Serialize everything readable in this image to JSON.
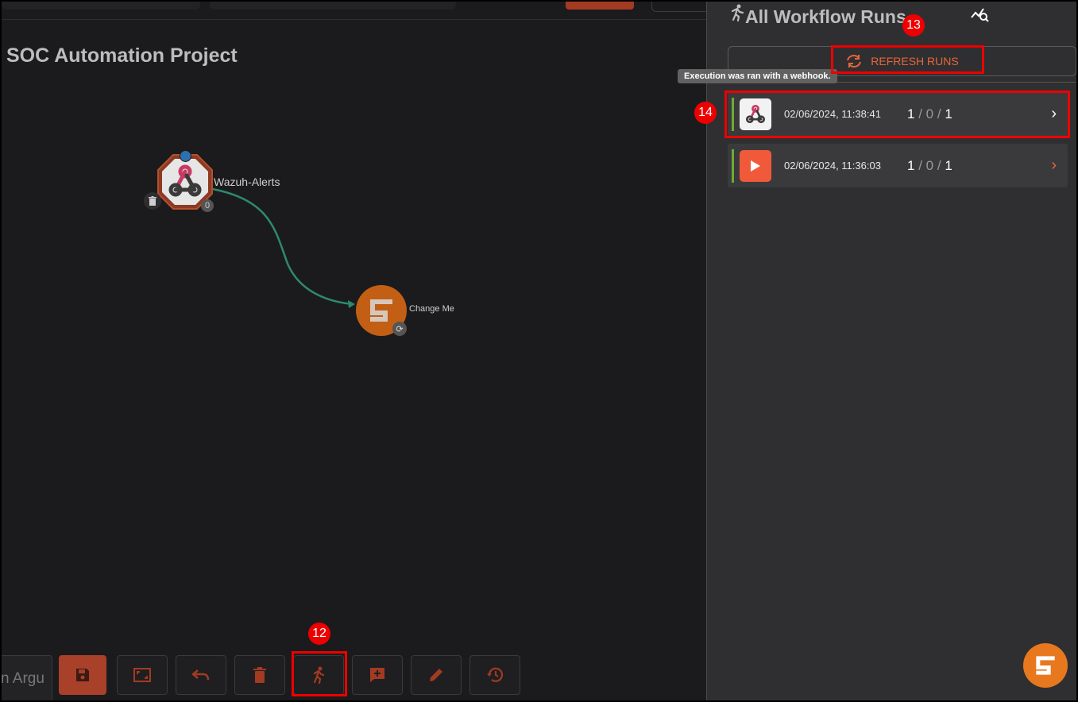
{
  "canvas": {
    "project_title": "SOC Automation Project",
    "nodes": [
      {
        "label": "Wazuh-Alerts",
        "count": "0"
      },
      {
        "label": "Change Me"
      }
    ]
  },
  "toolbar": {
    "argument_input_partial": "n Argu",
    "buttons": [
      "save-icon",
      "fit-screen-icon",
      "undo-icon",
      "delete-icon",
      "run-icon",
      "add-comment-icon",
      "edit-icon",
      "history-icon"
    ]
  },
  "annotations": {
    "badge_12": "12",
    "badge_13": "13",
    "badge_14": "14"
  },
  "panel": {
    "title": "All Workflow Runs",
    "refresh_label": "REFRESH RUNS",
    "tooltip": "Execution was ran with a webhook.",
    "runs": [
      {
        "timestamp": "02/06/2024, 11:38:41",
        "success": "1",
        "failed": "0",
        "total": "1",
        "source_icon": "webhook-icon",
        "chevron_color": "#ffffff"
      },
      {
        "timestamp": "02/06/2024, 11:36:03",
        "success": "1",
        "failed": "0",
        "total": "1",
        "source_icon": "play-icon",
        "chevron_color": "#e8653a"
      }
    ]
  },
  "colors": {
    "accent": "#e8653a",
    "status_success": "#6cab35",
    "annotation_red": "#ee0000"
  }
}
